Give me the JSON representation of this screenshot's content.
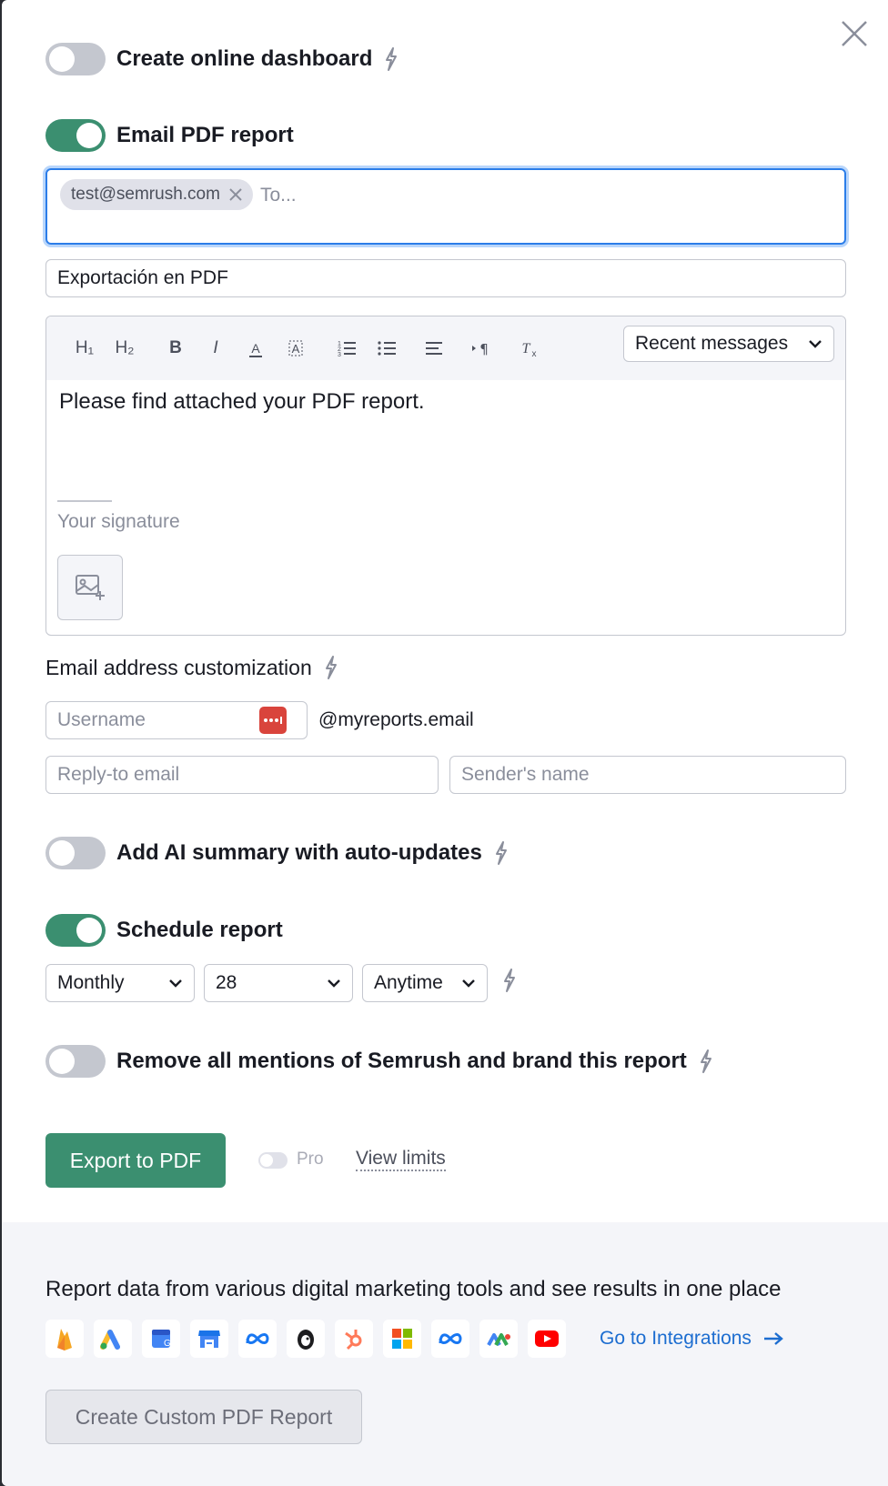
{
  "create_dashboard": {
    "label": "Create online dashboard",
    "on": false
  },
  "email_report": {
    "label": "Email PDF report",
    "on": true
  },
  "to_field": {
    "chip": "test@semrush.com",
    "placeholder": "To..."
  },
  "subject": "Exportación en PDF",
  "editor": {
    "toolbar": {
      "h1": "H₁",
      "h2": "H₂",
      "bold": "B",
      "italic": "I",
      "recent_messages": "Recent messages"
    },
    "body": "Please find attached your PDF report.",
    "signature_placeholder": "Your signature"
  },
  "email_customization": {
    "title": "Email address customization",
    "username_placeholder": "Username",
    "domain": "@myreports.email",
    "reply_to_placeholder": "Reply-to email",
    "sender_placeholder": "Sender's name"
  },
  "ai_summary": {
    "label": "Add AI summary with auto-updates",
    "on": false
  },
  "schedule": {
    "label": "Schedule report",
    "on": true,
    "frequency": "Monthly",
    "day": "28",
    "time": "Anytime"
  },
  "branding": {
    "label": "Remove all mentions of Semrush and brand this report",
    "on": false
  },
  "export_button": "Export to PDF",
  "pro_label": "Pro",
  "view_limits": "View limits",
  "footer": {
    "text": "Report data from various digital marketing tools and see results in one place",
    "integrations": [
      "firebase-icon",
      "google-ads-icon",
      "google-analytics-icon",
      "google-business-icon",
      "meta-icon",
      "mailchimp-icon",
      "hubspot-icon",
      "microsoft-icon",
      "meta-ads-icon",
      "looker-icon",
      "youtube-icon"
    ],
    "go_integrations": "Go to Integrations",
    "custom_report_button": "Create Custom PDF Report"
  },
  "colors": {
    "accent": "#3b8f70",
    "link": "#1c6dd0",
    "focus": "#2b7de9"
  }
}
